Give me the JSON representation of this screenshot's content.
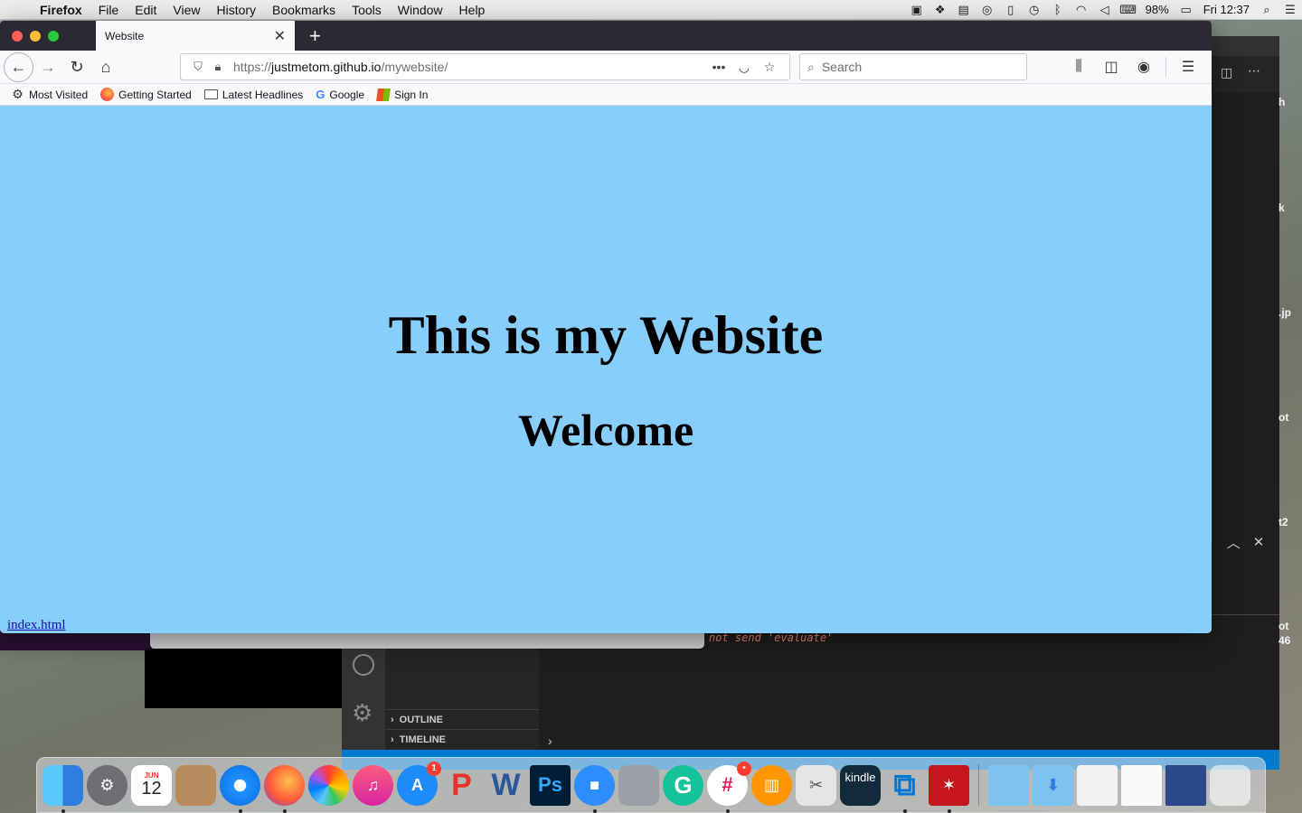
{
  "menubar": {
    "app_name": "Firefox",
    "items": [
      "File",
      "Edit",
      "View",
      "History",
      "Bookmarks",
      "Tools",
      "Window",
      "Help"
    ],
    "battery": "98%",
    "clock": "Fri 12:37"
  },
  "firefox": {
    "tab_title": "Website",
    "url": {
      "protocol": "https://",
      "domain": "justmetom.github.io",
      "path": "/mywebsite/"
    },
    "search_placeholder": "Search",
    "bookmarks": [
      "Most Visited",
      "Getting Started",
      "Latest Headlines",
      "Google",
      "Sign In"
    ],
    "status_link": "index.html"
  },
  "page": {
    "heading": "This is my Website",
    "subheading": "Welcome",
    "background_color": "#87cefa"
  },
  "vscode": {
    "error_text": "not send 'evaluate'",
    "sidebar_sections": [
      "OUTLINE",
      "TIMELINE"
    ]
  },
  "dock": {
    "calendar_month": "JUN",
    "calendar_day": "12",
    "appstore_badge": "1",
    "kindle_label": "kindle",
    "photoshop_label": "Ps",
    "word_label": "W"
  }
}
